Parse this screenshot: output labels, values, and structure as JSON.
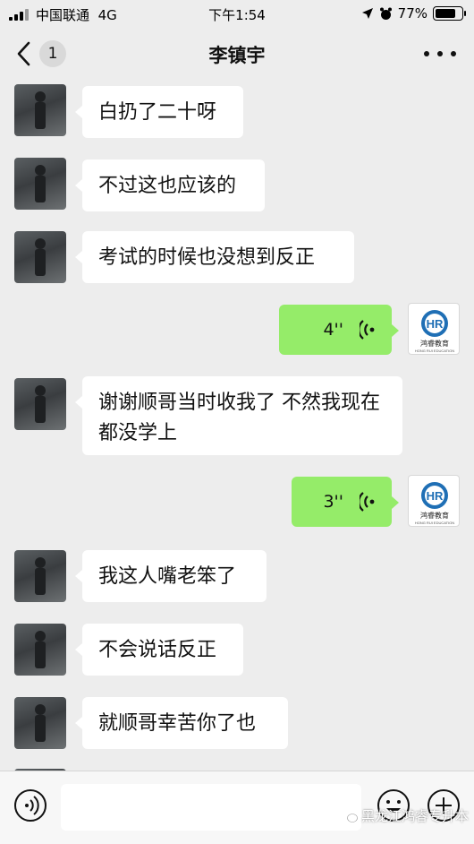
{
  "status_bar": {
    "carrier": "中国联通",
    "network": "4G",
    "time": "下午1:54",
    "battery": "77%",
    "battery_level": 0.77
  },
  "nav": {
    "back_count": "1",
    "title": "李镇宇",
    "back_icon": "chevron-left-icon",
    "more_icon": "more-icon"
  },
  "messages": [
    {
      "from": "friend",
      "type": "text",
      "text": "白扔了二十呀"
    },
    {
      "from": "friend",
      "type": "text",
      "text": "不过这也应该的"
    },
    {
      "from": "friend",
      "type": "text",
      "text": "考试的时候也没想到反正"
    },
    {
      "from": "self",
      "type": "voice",
      "duration": "4''"
    },
    {
      "from": "friend",
      "type": "text",
      "text": "谢谢顺哥当时收我了 不然我现在都没学上"
    },
    {
      "from": "self",
      "type": "voice",
      "duration": "3''"
    },
    {
      "from": "friend",
      "type": "text",
      "text": "我这人嘴老笨了"
    },
    {
      "from": "friend",
      "type": "text",
      "text": "不会说话反正"
    },
    {
      "from": "friend",
      "type": "text",
      "text": "就顺哥幸苦你了也"
    }
  ],
  "self_avatar": {
    "logo_letters": "HR",
    "brand": "鸿睿教育",
    "brand_en": "HONG RUI EDUCATION"
  },
  "input_bar": {
    "voice_icon": "voice-input-icon",
    "emoji_icon": "emoji-icon",
    "plus_icon": "plus-circle-icon",
    "text_value": ""
  },
  "watermark": "黑龙江鸿睿专升本",
  "colors": {
    "background": "#ededed",
    "incoming_bubble": "#ffffff",
    "outgoing_bubble": "#95ec69",
    "self_logo_blue": "#1f6fb5"
  }
}
